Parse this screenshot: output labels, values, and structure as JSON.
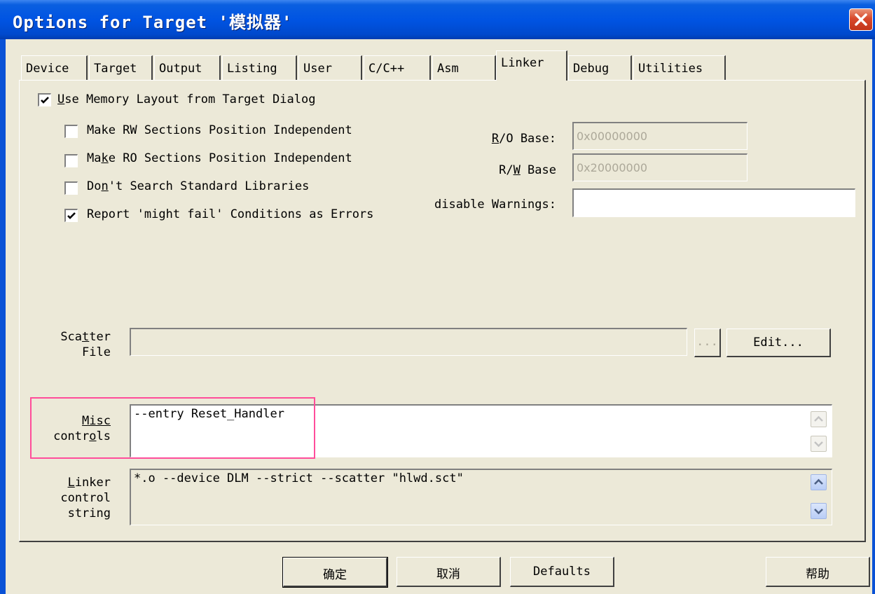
{
  "window": {
    "title": "Options for Target '模拟器'"
  },
  "tabs": [
    {
      "label": "Device"
    },
    {
      "label": "Target"
    },
    {
      "label": "Output"
    },
    {
      "label": "Listing"
    },
    {
      "label": "User"
    },
    {
      "label": "C/C++"
    },
    {
      "label": "Asm"
    },
    {
      "label": "Linker"
    },
    {
      "label": "Debug"
    },
    {
      "label": "Utilities"
    }
  ],
  "active_tab": "Linker",
  "options": {
    "use_memory_layout": {
      "pre": "",
      "u": "U",
      "post": "se Memory Layout from Target Dialog",
      "checked": true
    },
    "rw_independent": {
      "pre": "Make RW Sections Position Independent",
      "checked": false
    },
    "ro_independent": {
      "pre": "Ma",
      "u": "k",
      "post": "e RO Sections Position Independent",
      "checked": false
    },
    "dont_search": {
      "pre": "Do",
      "u": "n",
      "post": "'t Search Standard Libraries",
      "checked": false
    },
    "report_errors": {
      "pre": "Report 'might fail' Conditions as Errors",
      "checked": true
    }
  },
  "ro_base": {
    "pre": "",
    "u": "R",
    "post": "/O Base:",
    "value": "0x00000000"
  },
  "rw_base": {
    "pre": "R/",
    "u": "W",
    "post": " Base",
    "value": "0x20000000"
  },
  "disable_warnings": {
    "label": "disable Warnings:",
    "value": ""
  },
  "scatter_file": {
    "line1_pre": "Sca",
    "line1_u": "t",
    "line1_post": "ter",
    "line2": "File",
    "value": "",
    "browse_label": "...",
    "edit_label": "Edit..."
  },
  "misc_controls": {
    "line1": "Misc",
    "line2_pre": "contr",
    "line2_u": "o",
    "line2_post": "ls",
    "value": "--entry Reset_Handler"
  },
  "linker_control": {
    "line1_pre": "",
    "line1_u": "L",
    "line1_post": "inker",
    "line2": "control",
    "line3": "string",
    "value": "*.o --device DLM --strict --scatter \"hlwd.sct\""
  },
  "buttons": {
    "ok": "确定",
    "cancel": "取消",
    "defaults": "Defaults",
    "help": "帮助"
  },
  "colors": {
    "title_bar": "#0054e3",
    "highlight": "#ff4d9a",
    "dialog_bg": "#ece9d8"
  }
}
